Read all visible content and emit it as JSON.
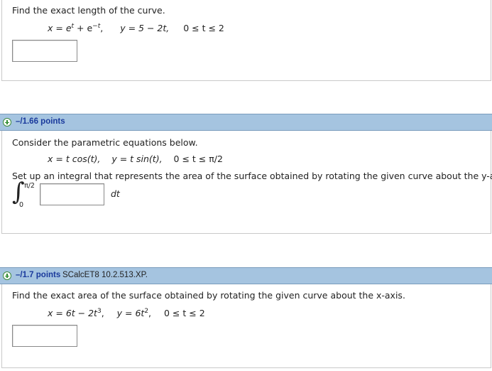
{
  "q1": {
    "prompt": "Find the exact length of the curve.",
    "equation": {
      "x": "x = e",
      "x_exp1": "t",
      "x_mid": " + e",
      "x_exp2": "−t",
      "x_end": ",",
      "y": "y = 5 − 2t,",
      "range": "0 ≤ t ≤ 2"
    }
  },
  "q2": {
    "points": "–/1.66 points",
    "prompt": "Consider the parametric equations below.",
    "equation": {
      "x": "x = t cos(t),",
      "y": "y = t sin(t),",
      "range": "0 ≤ t ≤ π/2"
    },
    "instruction": "Set up an integral that represents the area of the surface obtained by rotating the given curve about the y-axis.",
    "integral": {
      "upper": "π/2",
      "lower": "0",
      "differential": "dt"
    }
  },
  "q3": {
    "points": "–/1.7 points",
    "source": "SCalcET8 10.2.513.XP.",
    "prompt": "Find the exact area of the surface obtained by rotating the given curve about the x-axis.",
    "equation": {
      "x": "x = 6t − 2t",
      "x_exp": "3",
      "x_end": ",",
      "y": "y = 6t",
      "y_exp": "2",
      "y_end": ",",
      "range": "0 ≤ t ≤ 2"
    }
  }
}
